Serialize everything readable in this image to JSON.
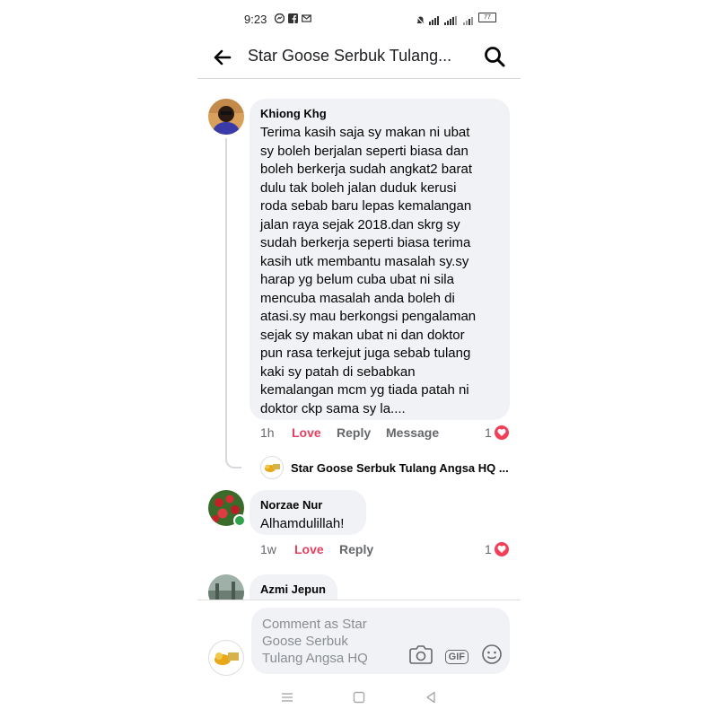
{
  "status_bar": {
    "time": "9:23",
    "battery": "77"
  },
  "header": {
    "title": "Star Goose Serbuk Tulang...",
    "back_icon": "back-arrow-icon",
    "search_icon": "search-icon"
  },
  "comments": [
    {
      "author": "Khiong Khg",
      "lines": [
        "Terima kasih saja sy makan ni ubat",
        "sy boleh berjalan seperti biasa dan",
        "boleh berkerja sudah angkat2 barat",
        "dulu tak boleh jalan duduk kerusi",
        "roda sebab baru lepas kemalangan",
        "jalan raya sejak 2018.dan skrg sy",
        "sudah berkerja seperti biasa terima",
        "kasih utk membantu masalah sy.sy",
        "harap yg belum cuba ubat ni sila",
        "mencuba masalah anda boleh di",
        "atasi.sy mau berkongsi pengalaman",
        "sejak sy makan ubat ni dan doktor",
        "pun rasa terkejut juga sebab tulang",
        "kaki sy patah di sebabkan",
        "kemalangan mcm yg tiada patah ni",
        "doktor ckp sama sy la...."
      ],
      "time": "1h",
      "love_label": "Love",
      "reply_label": "Reply",
      "message_label": "Message",
      "reaction_count": "1",
      "reply_preview": {
        "author": "Star Goose Serbuk Tulang Angsa HQ ..."
      }
    },
    {
      "author": "Norzae Nur",
      "text": "Alhamdulillah!",
      "time": "1w",
      "love_label": "Love",
      "reply_label": "Reply",
      "reaction_count": "1"
    },
    {
      "author": "Azmi Jepun"
    }
  ],
  "composer": {
    "placeholder_lines": [
      "Comment as Star",
      "Goose Serbuk",
      "Tulang Angsa HQ"
    ],
    "gif_label": "GIF"
  },
  "colors": {
    "love": "#e4405f",
    "bubble": "#f0f2f5",
    "heart": "#f33e58",
    "online": "#31a24c"
  }
}
